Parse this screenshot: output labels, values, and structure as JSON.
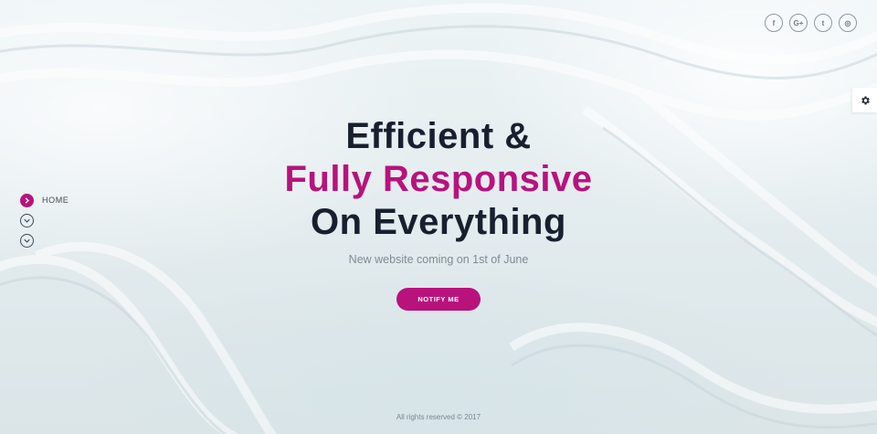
{
  "hero": {
    "line1": "Efficient &",
    "line2": "Fully Responsive",
    "line3": "On Everything",
    "subtitle": "New website coming on 1st of June",
    "cta": "NOTIFY ME"
  },
  "social": [
    {
      "name": "facebook-icon",
      "glyph": "f"
    },
    {
      "name": "google-plus-icon",
      "glyph": "G+"
    },
    {
      "name": "twitter-icon",
      "glyph": "t"
    },
    {
      "name": "instagram-icon",
      "glyph": "◎"
    }
  ],
  "nav": {
    "items": [
      {
        "label": "HOME",
        "active": true
      },
      {
        "label": "",
        "active": false
      },
      {
        "label": "",
        "active": false
      }
    ]
  },
  "footer": {
    "copyright": "All rights reserved © 2017"
  },
  "colors": {
    "accent": "#b8127d",
    "heading": "#18202f",
    "background": "#e7eff1"
  }
}
